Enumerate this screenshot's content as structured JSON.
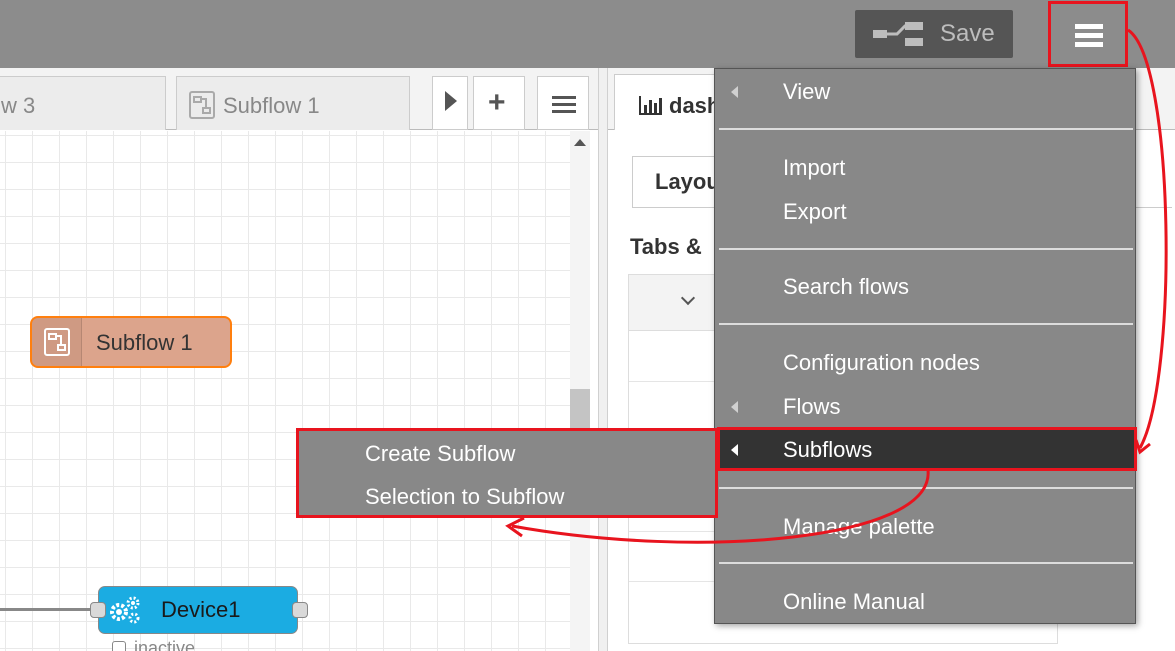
{
  "header": {
    "save_label": "Save",
    "menu_icon": "hamburger-menu-icon",
    "deploy_icon": "deploy-icon"
  },
  "tabs": [
    {
      "label": "w 3",
      "icon": ""
    },
    {
      "label": "Subflow 1",
      "icon": "subflow-icon"
    }
  ],
  "tab_controls": {
    "scroll_icon": "tab-scroll-right-icon",
    "add_icon": "add-flow-icon",
    "list_icon": "list-flows-icon"
  },
  "workspace": {
    "nodes": [
      {
        "label": "Subflow 1",
        "icon": "subflow-icon",
        "color": "#dca48c"
      },
      {
        "label": "Device1",
        "icon": "gears-icon",
        "color": "#1bace2",
        "status": "inactive"
      }
    ]
  },
  "sidebar": {
    "tab_label": "dash",
    "tab_icon": "bar-chart-icon",
    "subtab_label": "Layou",
    "heading": "Tabs &"
  },
  "menu": {
    "items": [
      {
        "label": "View",
        "submenu": true
      },
      {
        "label": "Import",
        "submenu": false
      },
      {
        "label": "Export",
        "submenu": false
      },
      {
        "label": "Search flows",
        "submenu": false
      },
      {
        "label": "Configuration nodes",
        "submenu": false
      },
      {
        "label": "Flows",
        "submenu": true
      },
      {
        "label": "Subflows",
        "submenu": true,
        "active": true
      },
      {
        "label": "Manage palette",
        "submenu": false
      },
      {
        "label": "Online Manual",
        "submenu": false
      }
    ]
  },
  "subflows_submenu": {
    "items": [
      {
        "label": "Create Subflow"
      },
      {
        "label": "Selection to Subflow"
      }
    ]
  },
  "colors": {
    "header_bg": "#8c8c8c",
    "menu_bg": "#888888",
    "menu_active_bg": "#333333",
    "annotation_red": "#e8141e",
    "subflow_node": "#dca48c",
    "subflow_border": "#ff7f0e",
    "device_node": "#1bace2"
  }
}
